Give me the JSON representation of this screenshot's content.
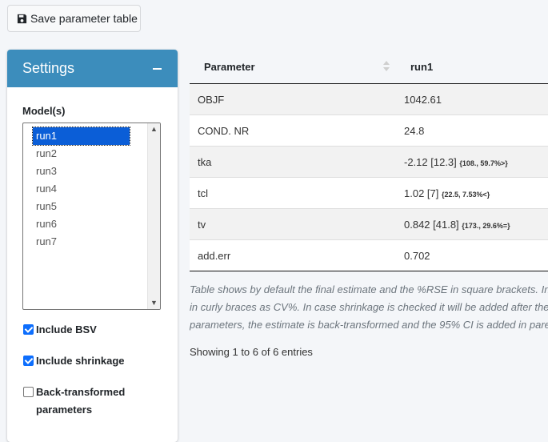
{
  "toolbar": {
    "save_label": "Save parameter table",
    "save_icon": "floppy-disk-icon"
  },
  "settings": {
    "title": "Settings",
    "collapse_icon": "minus-icon",
    "models_label": "Model(s)",
    "models": [
      "run1",
      "run2",
      "run3",
      "run4",
      "run5",
      "run6",
      "run7"
    ],
    "selected_model": "run1",
    "checkboxes": [
      {
        "label": "Include BSV",
        "checked": true
      },
      {
        "label": "Include shrinkage",
        "checked": true
      },
      {
        "label": "Back-transformed parameters",
        "checked": false
      }
    ]
  },
  "table": {
    "headers": [
      "Parameter",
      "run1"
    ],
    "rows": [
      {
        "param": "OBJF",
        "value": "1042.61",
        "extra": ""
      },
      {
        "param": "COND. NR",
        "value": "24.8",
        "extra": ""
      },
      {
        "param": "tka",
        "value": "-2.12 [12.3]",
        "extra": "{108., 59.7%>}"
      },
      {
        "param": "tcl",
        "value": "1.02 [7]",
        "extra": "{22.5, 7.53%<}"
      },
      {
        "param": "tv",
        "value": "0.842 [41.8]",
        "extra": "{173., 29.6%=}"
      },
      {
        "param": "add.err",
        "value": "0.702",
        "extra": ""
      }
    ],
    "caption_lines": [
      "Table shows by default the final estimate and the %RSE in square brackets. In",
      "in curly braces as CV%. In case shrinkage is checked it will be added after the",
      "parameters, the estimate is back-transformed and the 95% CI is added in pare"
    ],
    "info": "Showing 1 to 6 of 6 entries"
  },
  "colors": {
    "header_bg": "#3c8dbc",
    "selection": "#0b5ed7",
    "checkbox": "#0d6efd"
  }
}
